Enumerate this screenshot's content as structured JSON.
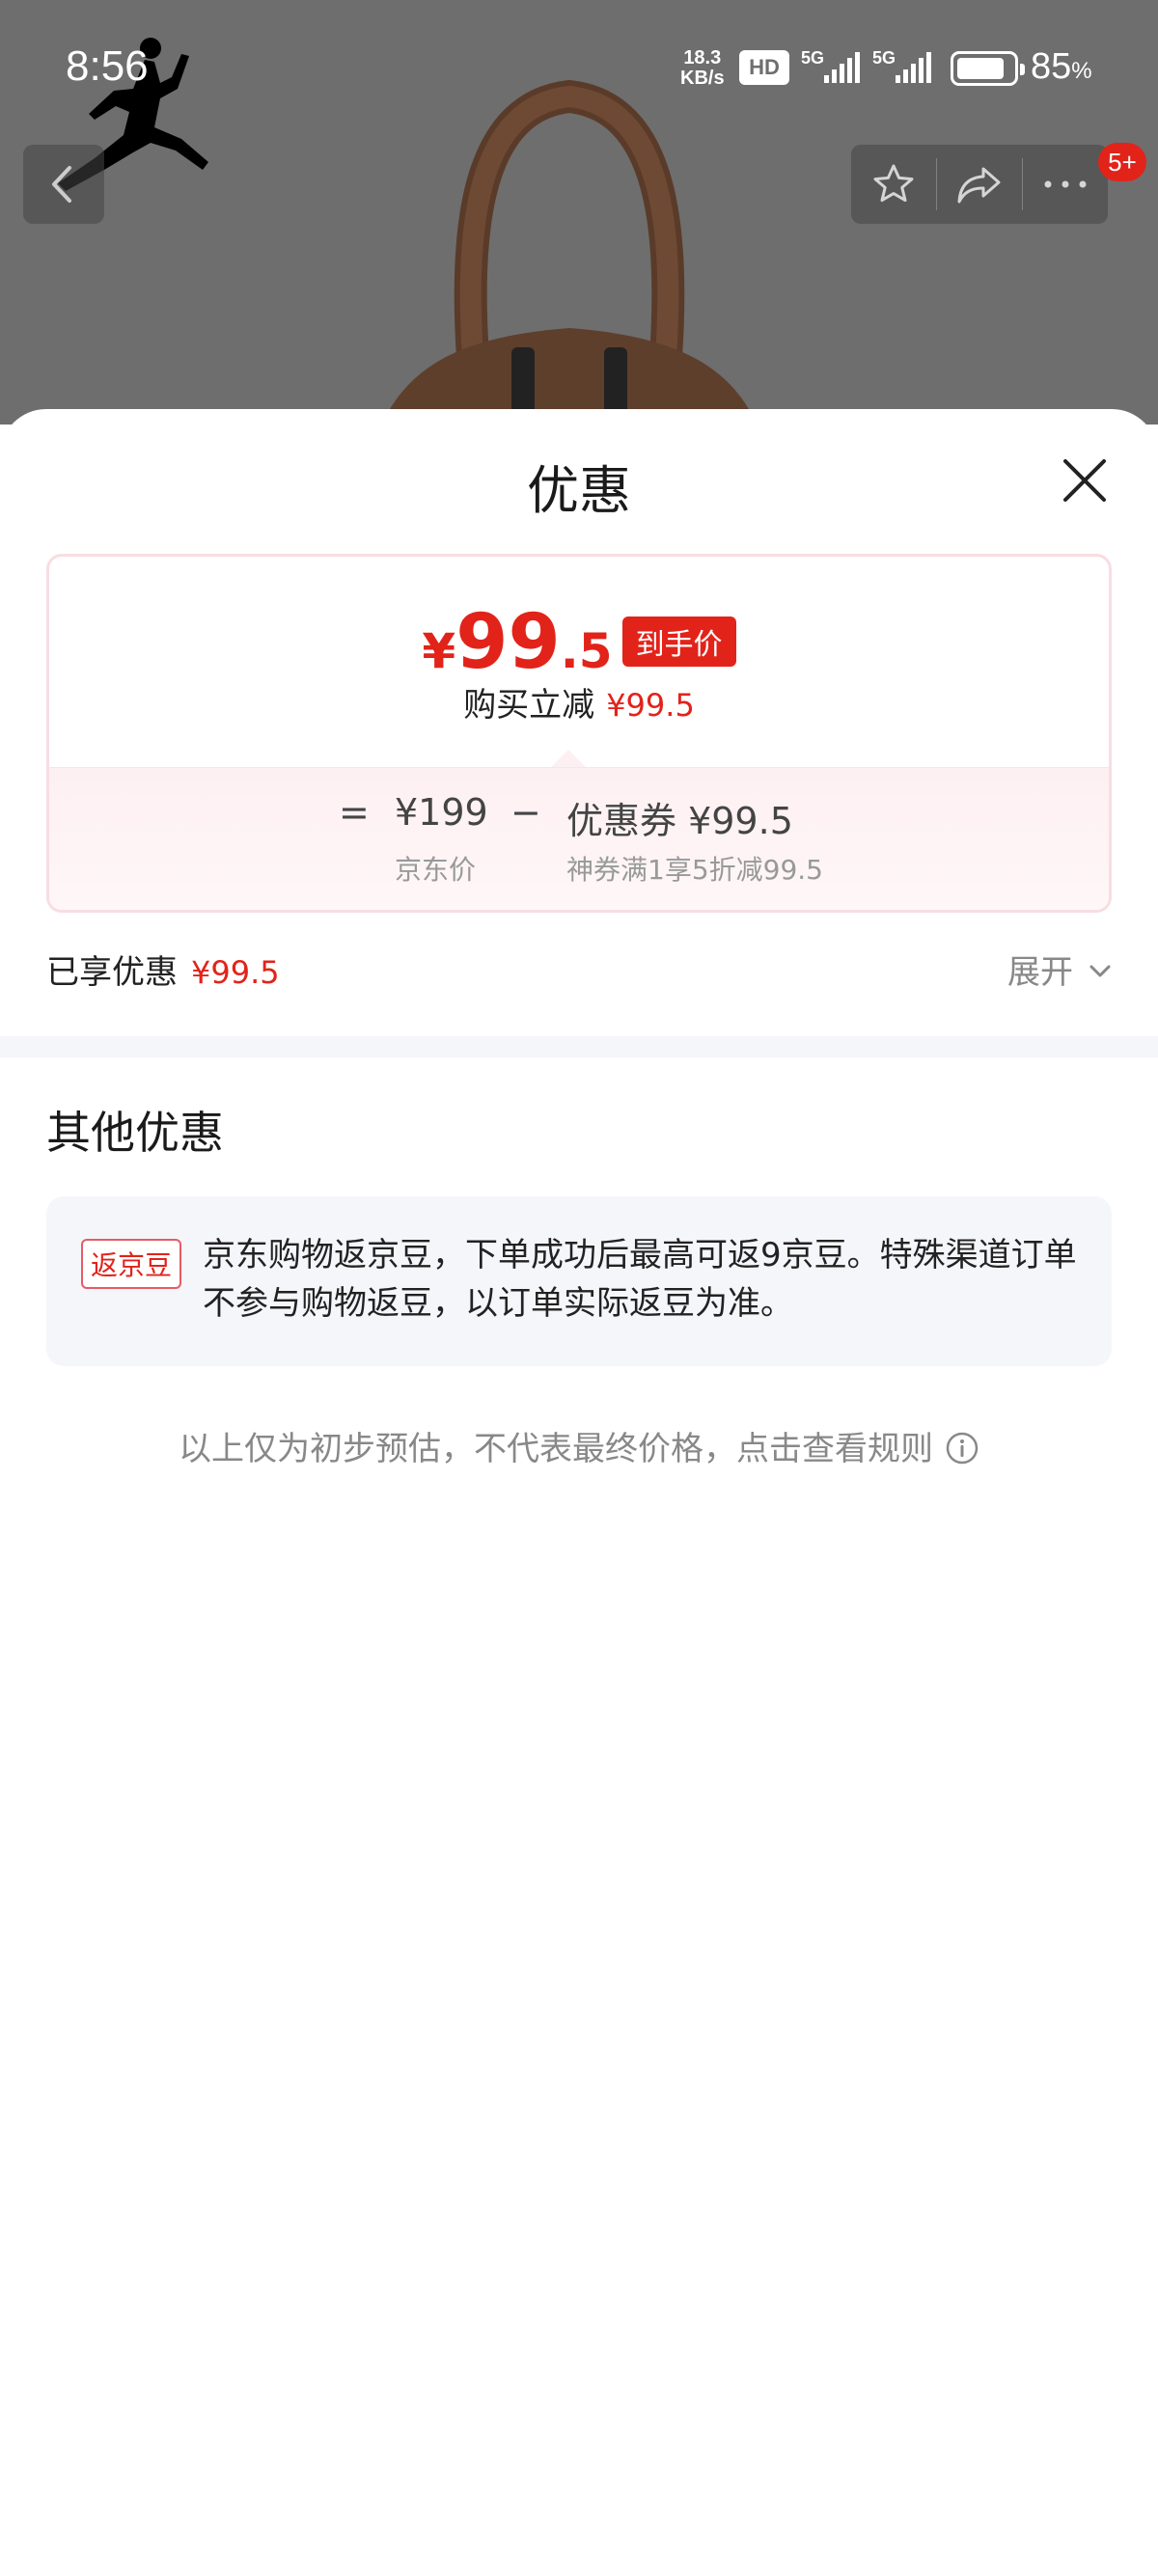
{
  "status_bar": {
    "time": "8:56",
    "net_speed_value": "18.3",
    "net_speed_unit": "KB/s",
    "hd_label": "HD",
    "signal1_label": "5G",
    "signal2_label": "5G",
    "battery_level": 0.85,
    "battery_percent": "85",
    "battery_percent_sign": "%"
  },
  "header": {
    "message_badge": "5+",
    "icons": [
      "back-arrow-icon",
      "star-icon",
      "share-icon",
      "more-icon"
    ]
  },
  "sheet": {
    "title": "优惠",
    "price_card": {
      "final_yen": "¥",
      "final_int": "99",
      "final_dec": ".5",
      "final_tag": "到手价",
      "reduce_label": "购买立减",
      "reduce_value": "¥99.5",
      "equals": "=",
      "orig_value": "¥199",
      "orig_label": "京东价",
      "minus": "−",
      "coupon_value": "优惠券 ¥99.5",
      "coupon_desc": "神券满1享5折减99.5"
    },
    "enjoyed_label": "已享优惠",
    "enjoyed_value": "¥99.5",
    "expand_label": "展开"
  },
  "other": {
    "title": "其他优惠",
    "tag": "返京豆",
    "text": "京东购物返京豆，下单成功后最高可返9京豆。特殊渠道订单不参与购物返豆，以订单实际返豆为准。"
  },
  "footnote": "以上仅为初步预估，不代表最终价格，点击查看规则",
  "colors": {
    "accent": "#e2231a",
    "overlay": "#6e6e6e",
    "card_border": "#f8dde2",
    "panel_bg": "#f5f6fa"
  }
}
